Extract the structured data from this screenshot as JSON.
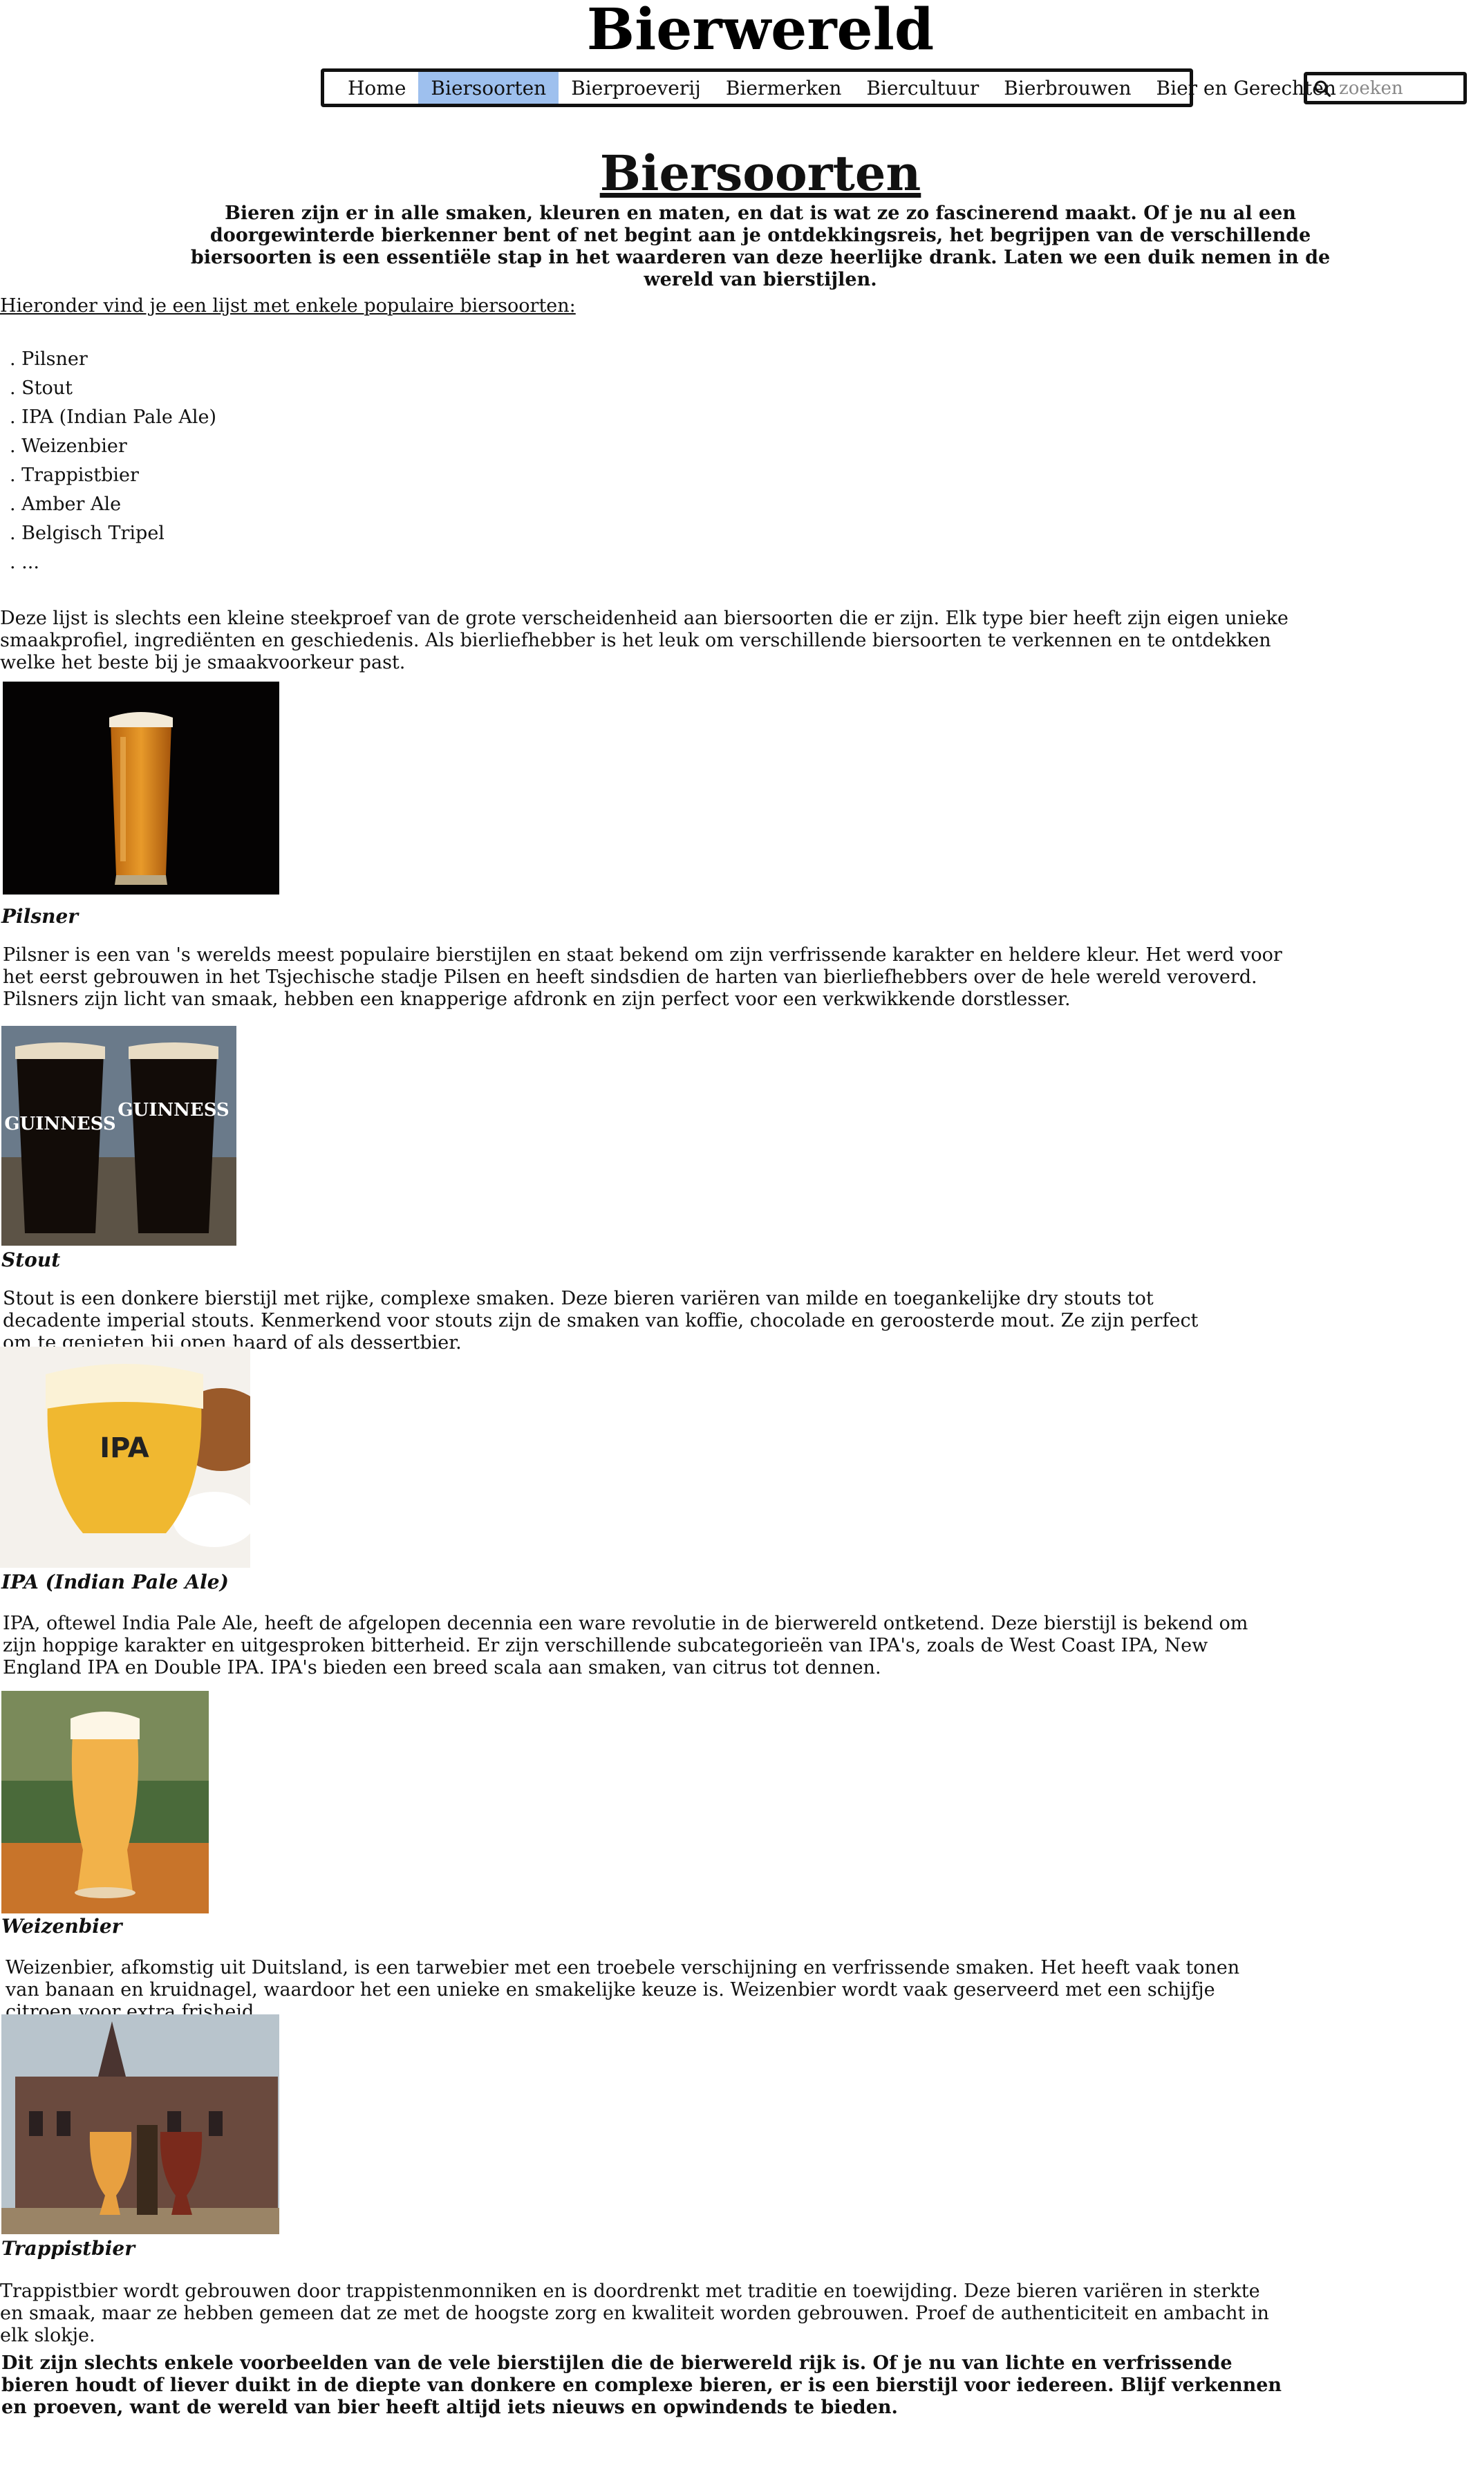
{
  "site": {
    "title": "Bierwereld"
  },
  "nav": {
    "items": [
      "Home",
      "Biersoorten",
      "Bierproeverij",
      "Biermerken",
      "Biercultuur",
      "Bierbrouwen",
      "Bier en Gerechten"
    ],
    "active": "Biersoorten"
  },
  "search": {
    "placeholder": "zoeken"
  },
  "main": {
    "title": "Biersoorten",
    "intro": "Bieren zijn er in alle smaken, kleuren en maten, en dat is wat ze zo fascinerend maakt. Of je nu al een doorgewinterde bierkenner bent of net begint aan je ontdekkingsreis, het begrijpen van de verschillende biersoorten is een essentiële stap in het waarderen van deze heerlijke drank. Laten we een duik nemen in de wereld van bierstijlen.",
    "list_heading": "Hieronder vind je een lijst met enkele populaire biersoorten:",
    "list": [
      ". Pilsner",
      ". Stout",
      ". IPA (Indian Pale Ale)",
      ". Weizenbier",
      ". Trappistbier",
      ". Amber Ale",
      ". Belgisch Tripel",
      ". ..."
    ],
    "summary": "Deze lijst is slechts een kleine steekproef van de grote verscheidenheid aan biersoorten die er zijn. Elk type bier heeft zijn eigen unieke smaakprofiel, ingrediënten en geschiedenis. Als bierliefhebber is het leuk om verschillende biersoorten te verkennen en te ontdekken welke het beste bij je smaakvoorkeur past.",
    "beers": [
      {
        "name": "Pilsner",
        "image_label": "glas pilsner",
        "text": "Pilsner is een van 's werelds meest populaire bierstijlen en staat bekend om zijn verfrissende karakter en heldere kleur. Het werd voor het eerst gebrouwen in het Tsjechische stadje Pilsen en heeft sindsdien de harten van bierliefhebbers over de hele wereld veroverd. Pilsners zijn licht van smaak, hebben een knapperige afdronk en zijn perfect voor een verkwikkende dorstlesser."
      },
      {
        "name": "Stout",
        "image_label": "twee glazen stout",
        "text": "Stout is een donkere bierstijl met rijke, complexe smaken. Deze bieren variëren van milde en toegankelijke dry stouts tot decadente imperial stouts. Kenmerkend voor stouts zijn de smaken van koffie, chocolade en geroosterde mout. Ze zijn perfect om te genieten bij open haard of als dessertbier."
      },
      {
        "name": "IPA (Indian Pale Ale)",
        "image_label": "IPA",
        "text": "IPA, oftewel India Pale Ale, heeft de afgelopen decennia een ware revolutie in de bierwereld ontketend. Deze bierstijl is bekend om zijn hoppige karakter en uitgesproken bitterheid. Er zijn verschillende subcategorieën van IPA's, zoals de West Coast IPA, New England IPA en Double IPA. IPA's bieden een breed scala aan smaken, van citrus tot dennen."
      },
      {
        "name": "Weizenbier",
        "image_label": "glas weizen",
        "text": "Weizenbier, afkomstig uit Duitsland, is een tarwebier met een troebele verschijning en verfrissende smaken. Het heeft vaak tonen van banaan en kruidnagel, waardoor het een unieke en smakelijke keuze is. Weizenbier wordt vaak geserveerd met een schijfje citroen voor extra frisheid."
      },
      {
        "name": "Trappistbier",
        "image_label": "abdij met trappistbier",
        "text": "Trappistbier wordt gebrouwen door trappistenmonniken en is doordrenkt met traditie en toewijding. Deze bieren variëren in sterkte en smaak, maar ze hebben gemeen dat ze met de hoogste zorg en kwaliteit worden gebrouwen. Proef de authenticiteit en ambacht in elk slokje."
      }
    ],
    "closing": "Dit zijn slechts enkele voorbeelden van de vele bierstijlen die de bierwereld rijk is. Of je nu van lichte en verfrissende bieren houdt of liever duikt in de diepte van donkere en complexe bieren, er is een bierstijl voor iedereen. Blijf verkennen en proeven, want de wereld van bier heeft altijd iets nieuws en opwindends te bieden."
  },
  "colors": {
    "nav_active": "#9ec0ee",
    "text": "#111111"
  }
}
